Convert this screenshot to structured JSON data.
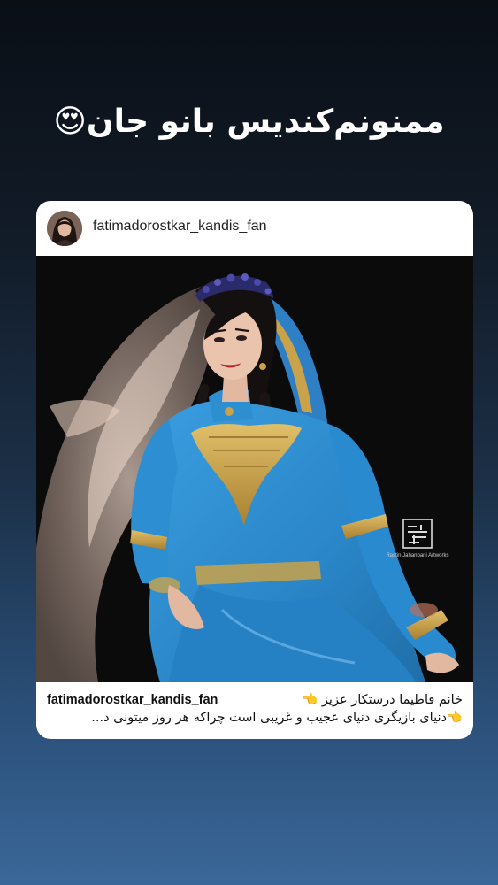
{
  "story": {
    "text": "ممنونم‌کندیس بانو جان😍"
  },
  "post": {
    "username": "fatimadorostkar_kandis_fan",
    "avatar_icon": "profile-photo",
    "image_subject": "dancer-in-blue-persian-dress",
    "watermark": {
      "text": "Rastin Jahanbani Artworks"
    },
    "caption": {
      "username": "fatimadorostkar_kandis_fan",
      "line1": "خانم فاطیما درستکار عزیز 👈",
      "line2": "👈دنیای بازیگری دنیای عجیب و غریبی است چراکه هر روز میتونی د..."
    }
  },
  "colors": {
    "background_top": "#0a0f16",
    "background_bottom": "#3a6799",
    "card": "#ffffff",
    "dress_blue": "#2e8fd0",
    "gold": "#c9a24a"
  }
}
